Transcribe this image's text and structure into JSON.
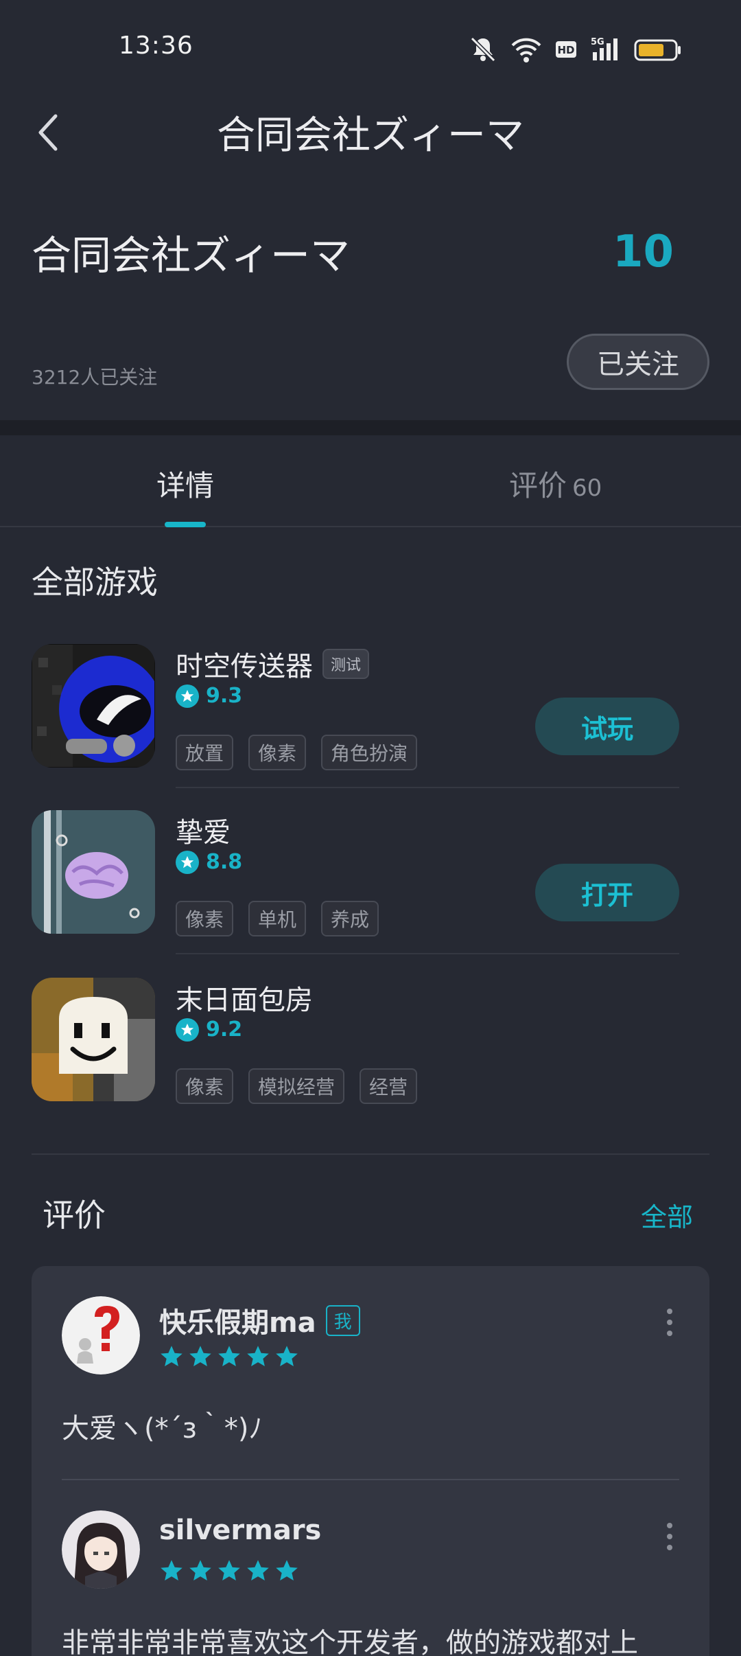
{
  "status_bar": {
    "time": "13:36"
  },
  "nav": {
    "title": "合同会社ズィーマ"
  },
  "developer": {
    "name": "合同会社ズィーマ",
    "score": "10",
    "followers": "3212人已关注",
    "follow_label": "已关注"
  },
  "tabs": [
    {
      "label": "详情",
      "count": ""
    },
    {
      "label": "评价",
      "count": "60"
    }
  ],
  "games_section": {
    "title": "全部游戏"
  },
  "games": [
    {
      "name": "时空传送器",
      "badge": "测试",
      "rating": "9.3",
      "tags": [
        "放置",
        "像素",
        "角色扮演"
      ],
      "action": "试玩"
    },
    {
      "name": "挚爱",
      "badge": "",
      "rating": "8.8",
      "tags": [
        "像素",
        "单机",
        "养成"
      ],
      "action": "打开"
    },
    {
      "name": "末日面包房",
      "badge": "",
      "rating": "9.2",
      "tags": [
        "像素",
        "模拟经营",
        "经营"
      ],
      "action": ""
    }
  ],
  "reviews_section": {
    "title": "评价",
    "all_label": "全部"
  },
  "reviews": [
    {
      "user": "快乐假期ma",
      "badge": "我",
      "stars": 5,
      "text": "大爱ヽ(*´з｀*)ﾉ"
    },
    {
      "user": "silvermars",
      "badge": "",
      "stars": 5,
      "text": "非常非常非常喜欢这个开发者，做的游戏都对上"
    }
  ],
  "colors": {
    "accent": "#18b6c9",
    "background": "#262933",
    "card": "#333641"
  }
}
